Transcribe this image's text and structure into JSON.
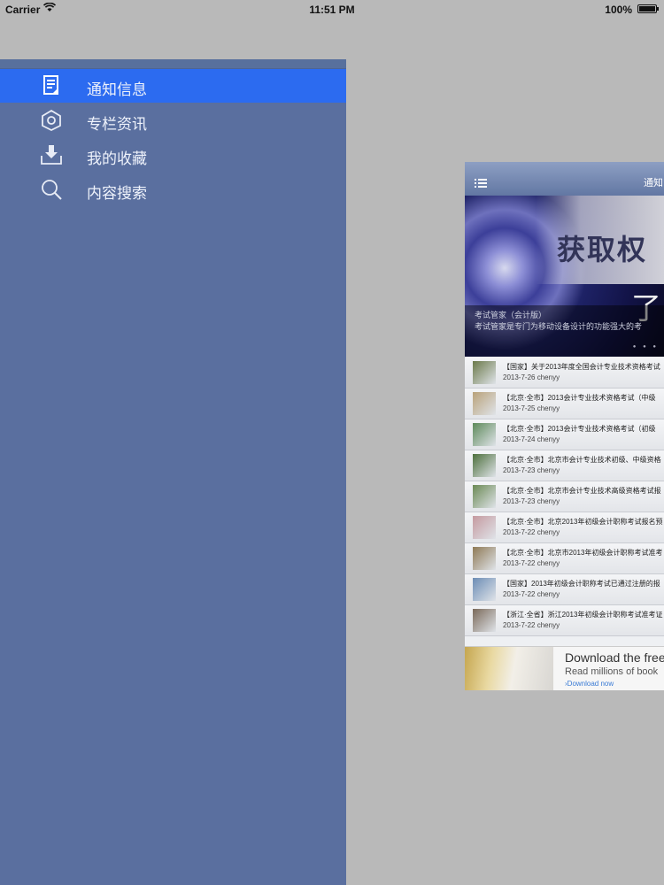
{
  "status_bar": {
    "carrier": "Carrier",
    "time": "11:51 PM",
    "battery": "100%"
  },
  "sidebar": {
    "items": [
      {
        "label": "通知信息",
        "icon": "notice-icon",
        "active": true
      },
      {
        "label": "专栏资讯",
        "icon": "gear-icon",
        "active": false
      },
      {
        "label": "我的收藏",
        "icon": "download-tray-icon",
        "active": false
      },
      {
        "label": "内容搜索",
        "icon": "search-icon",
        "active": false
      }
    ]
  },
  "preview": {
    "nav_title": "通知",
    "banner": {
      "headline": "获取权",
      "headline2": "了",
      "caption_title": "考试管家（会计版）",
      "caption_text": "考试管家是专门为移动设备设计的功能强大的考"
    },
    "articles": [
      {
        "title": "【国家】关于2013年度全国会计专业技术资格考试",
        "date": "2013-7-26",
        "author": "chenyy",
        "thumb": "#6b7a4a"
      },
      {
        "title": "【北京·全市】2013会计专业技术资格考试（中级",
        "date": "2013-7-25",
        "author": "chenyy",
        "thumb": "#b9a27a"
      },
      {
        "title": "【北京·全市】2013会计专业技术资格考试（初级",
        "date": "2013-7-24",
        "author": "chenyy",
        "thumb": "#5d8a5a"
      },
      {
        "title": "【北京·全市】北京市会计专业技术初级、中级资格",
        "date": "2013-7-23",
        "author": "chenyy",
        "thumb": "#4c6f3c"
      },
      {
        "title": "【北京·全市】北京市会计专业技术高级资格考试报",
        "date": "2013-7-23",
        "author": "chenyy",
        "thumb": "#6b8a54"
      },
      {
        "title": "【北京·全市】北京2013年初级会计职称考试报名预",
        "date": "2013-7-22",
        "author": "chenyy",
        "thumb": "#c59aa0"
      },
      {
        "title": "【北京·全市】北京市2013年初级会计职称考试准考",
        "date": "2013-7-22",
        "author": "chenyy",
        "thumb": "#8f7a55"
      },
      {
        "title": "【国家】2013年初级会计职称考试已通过注册的报",
        "date": "2013-7-22",
        "author": "chenyy",
        "thumb": "#6c8db5"
      },
      {
        "title": "【浙江·全省】浙江2013年初级会计职称考试准考证",
        "date": "2013-7-22",
        "author": "chenyy",
        "thumb": "#7b6a5a"
      }
    ],
    "ad": {
      "headline": "Download the free",
      "subline": "Read millions of book",
      "link": "›Download now"
    }
  }
}
